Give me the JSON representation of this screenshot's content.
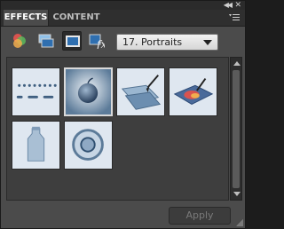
{
  "panel": {
    "tabs": [
      {
        "label": "EFFECTS",
        "active": true
      },
      {
        "label": "CONTENT",
        "active": false
      }
    ],
    "icons": {
      "collapse": "double-chevron-left-icon",
      "close": "close-icon",
      "menu": "panel-menu-icon"
    }
  },
  "toolbar": {
    "tools": [
      {
        "name": "color-circles-icon",
        "selected": false
      },
      {
        "name": "layer-styles-icon",
        "selected": false
      },
      {
        "name": "photo-effects-icon",
        "selected": true
      },
      {
        "name": "filters-icon",
        "selected": false
      }
    ],
    "category": {
      "selected": "17. Portraits"
    }
  },
  "effects_grid": {
    "items": [
      {
        "name": "perforated-lines-effect",
        "selected": false
      },
      {
        "name": "apple-portrait-effect",
        "selected": true
      },
      {
        "name": "brush-layers-effect",
        "selected": false
      },
      {
        "name": "color-brush-effect",
        "selected": false
      },
      {
        "name": "bottle-effect",
        "selected": false
      },
      {
        "name": "ring-glow-effect",
        "selected": false
      }
    ]
  },
  "footer": {
    "apply_label": "Apply",
    "apply_enabled": false
  },
  "colors": {
    "panel_bg": "#4b4b4b",
    "tabbar_bg": "#2f2f2f",
    "grid_bg": "#3e3e3e",
    "thumb_bg": "#dfe7f0",
    "accent_blue": "#2f6fb0"
  }
}
